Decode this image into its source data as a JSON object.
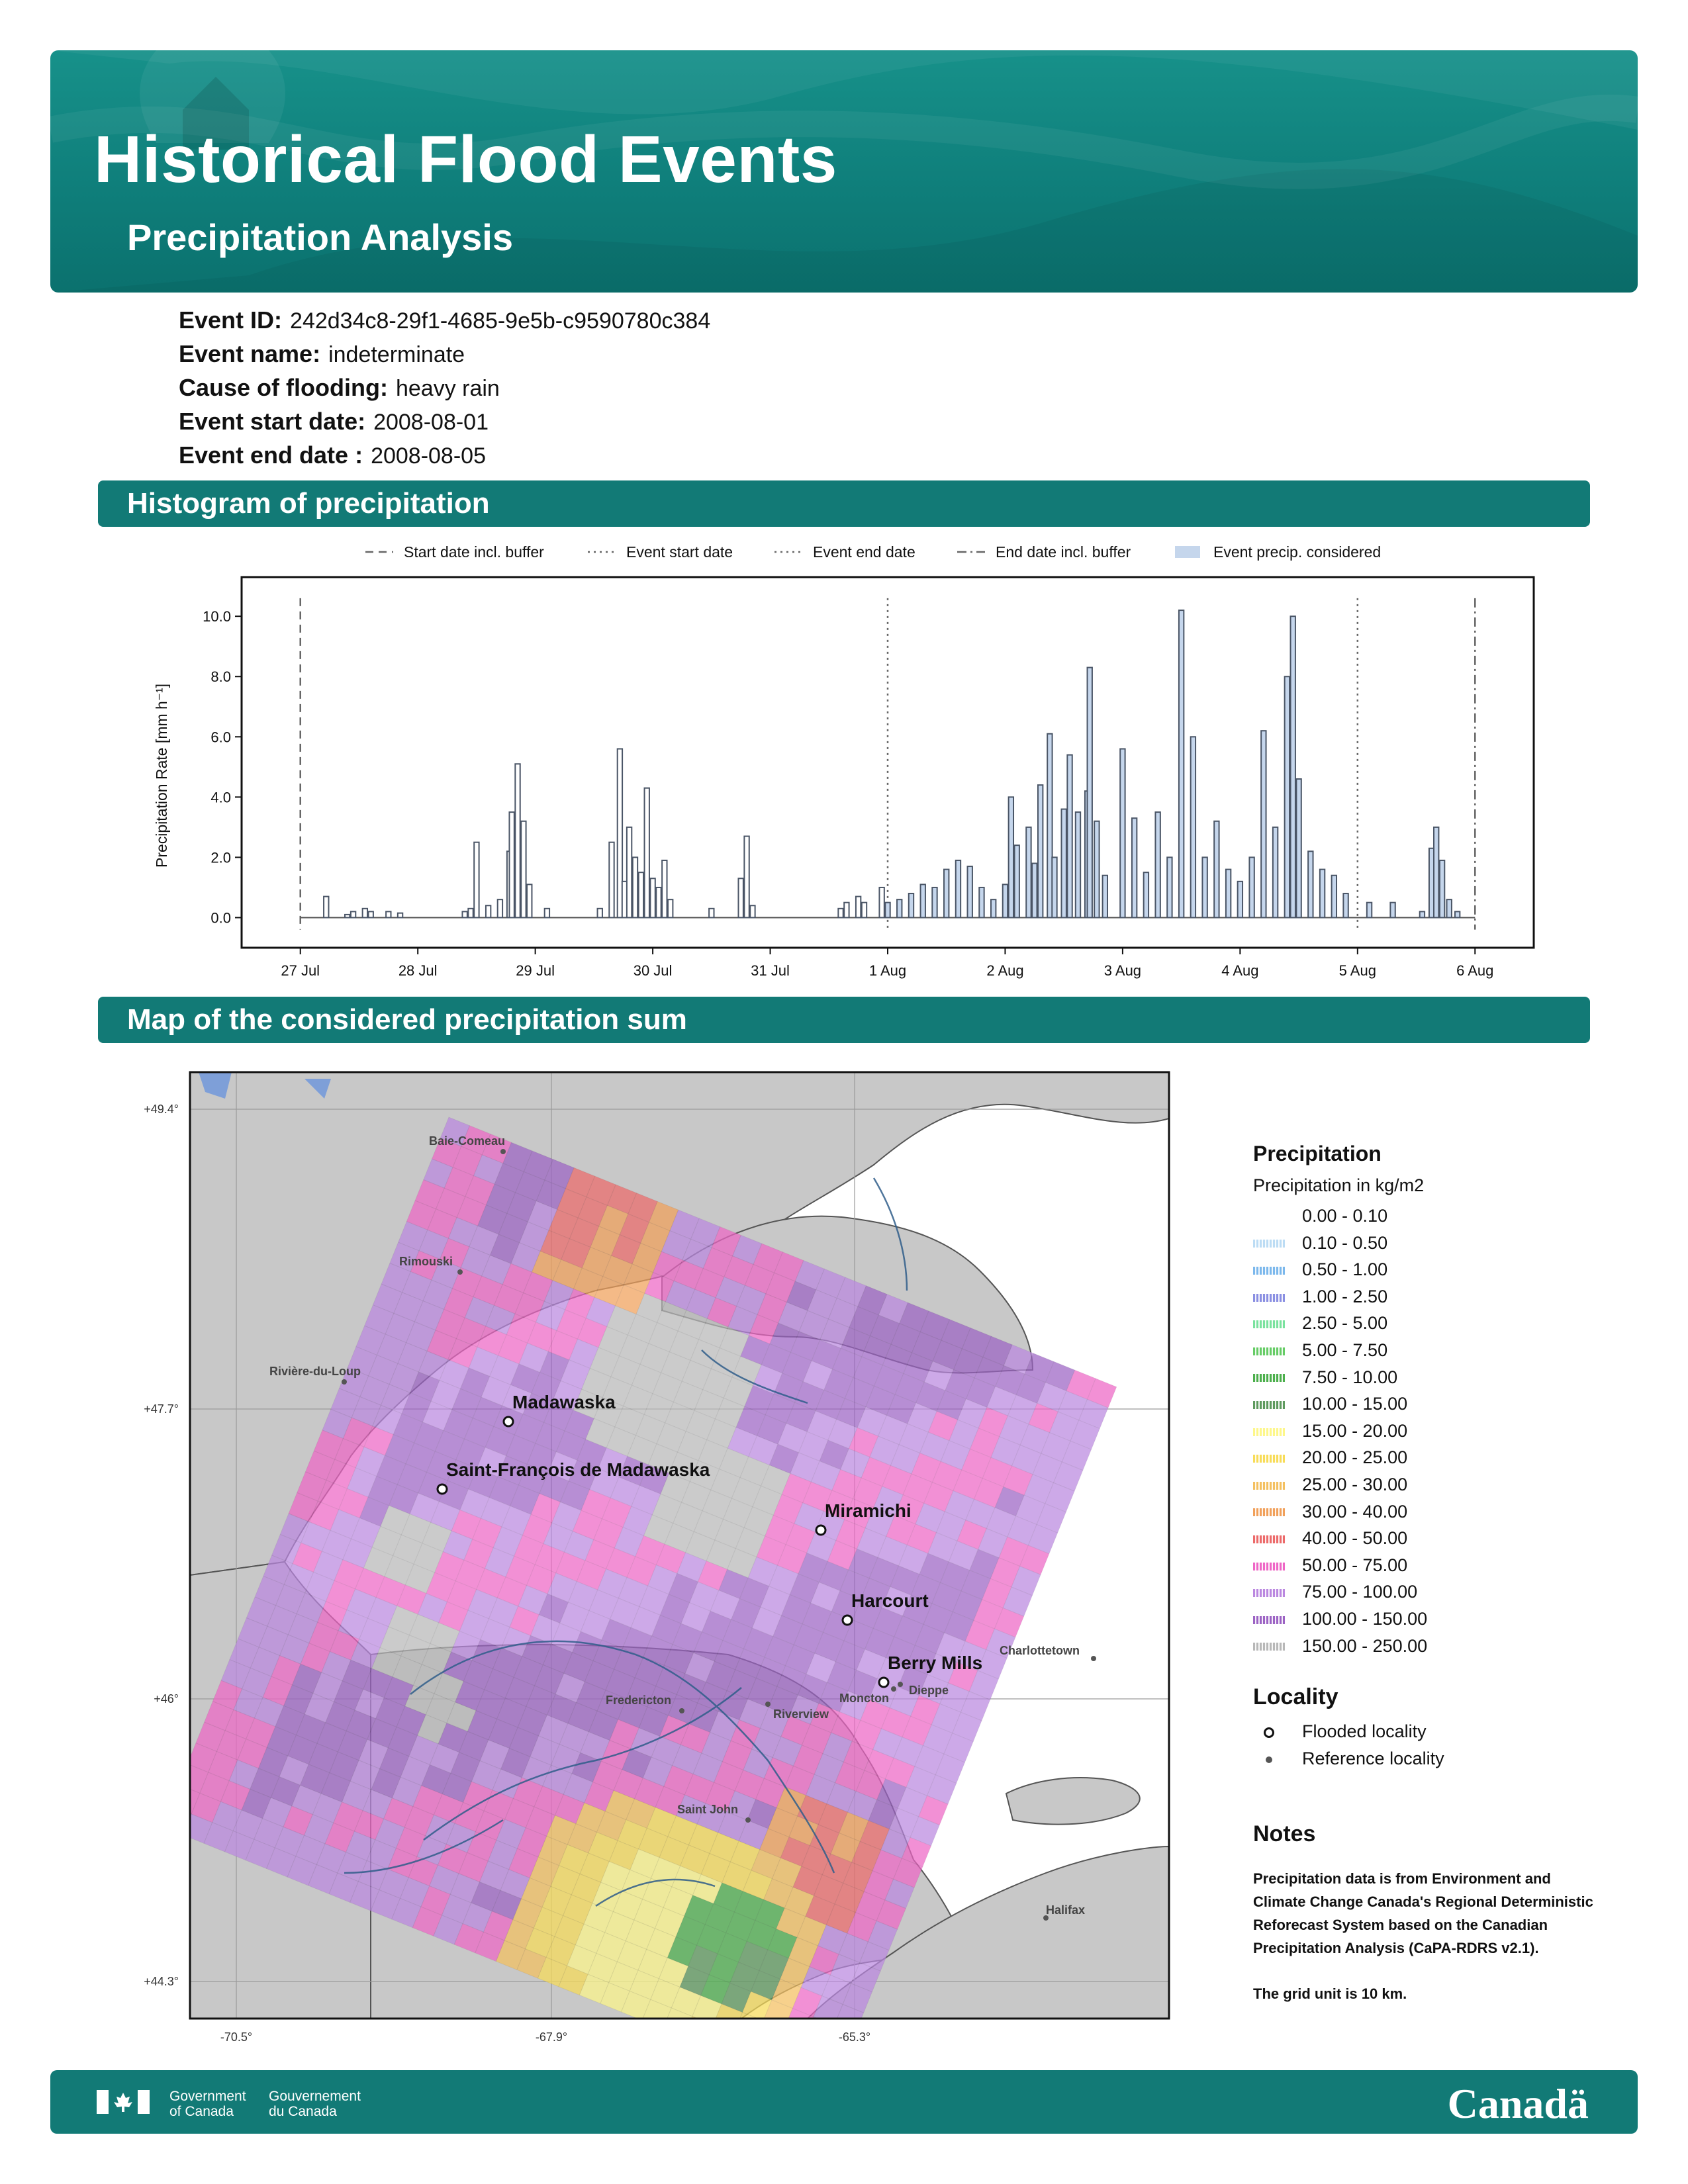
{
  "header": {
    "title": "Historical Flood Events",
    "subtitle": "Precipitation Analysis"
  },
  "event": {
    "id_label": "Event ID:",
    "id_value": "242d34c8-29f1-4685-9e5b-c9590780c384",
    "name_label": "Event name:",
    "name_value": "indeterminate",
    "cause_label": "Cause of flooding:",
    "cause_value": "heavy rain",
    "start_label": "Event start date:",
    "start_value": "2008-08-01",
    "end_label": "Event end date :",
    "end_value": "2008-08-05"
  },
  "sections": {
    "histogram": "Histogram of precipitation",
    "map": "Map of the considered precipitation sum"
  },
  "chart_data": {
    "type": "bar",
    "ylabel": "Precipitation Rate [mm h⁻¹]",
    "ylim": [
      -1.0,
      11.3
    ],
    "yticks": [
      "0.0",
      "2.0",
      "4.0",
      "6.0",
      "8.0",
      "10.0"
    ],
    "ytick_values": [
      0,
      2,
      4,
      6,
      8,
      10
    ],
    "x_ticks": [
      "27 Jul",
      "28 Jul",
      "29 Jul",
      "30 Jul",
      "31 Jul",
      "1 Aug",
      "2 Aug",
      "3 Aug",
      "4 Aug",
      "5 Aug",
      "6 Aug"
    ],
    "xlim": [
      -0.5,
      10.5
    ],
    "legend": [
      {
        "label": "Start date incl. buffer",
        "style": "dashed"
      },
      {
        "label": "Event start date",
        "style": "dotted"
      },
      {
        "label": "Event end date",
        "style": "dotted"
      },
      {
        "label": "End date incl. buffer",
        "style": "dashdot"
      },
      {
        "label": "Event precip. considered",
        "style": "patch"
      }
    ],
    "markers": {
      "buffer_start": 0,
      "event_start": 5,
      "event_end": 9,
      "buffer_end": 10
    },
    "series": [
      {
        "values": [
          [
            0.22,
            0.7
          ],
          [
            0.4,
            0.1
          ],
          [
            0.45,
            0.2
          ],
          [
            0.55,
            0.3
          ],
          [
            0.6,
            0.2
          ],
          [
            0.75,
            0.2
          ],
          [
            0.85,
            0.15
          ],
          [
            1.4,
            0.2
          ],
          [
            1.45,
            0.3
          ],
          [
            1.5,
            2.5
          ],
          [
            1.6,
            0.4
          ],
          [
            1.7,
            0.6
          ],
          [
            1.78,
            2.2
          ],
          [
            1.8,
            3.5
          ],
          [
            1.85,
            5.1
          ],
          [
            1.9,
            3.2
          ],
          [
            1.95,
            1.1
          ],
          [
            2.1,
            0.3
          ],
          [
            2.55,
            0.3
          ],
          [
            2.65,
            2.5
          ],
          [
            2.72,
            5.6
          ],
          [
            2.76,
            1.2
          ],
          [
            2.8,
            3.0
          ],
          [
            2.85,
            2.0
          ],
          [
            2.9,
            1.5
          ],
          [
            2.95,
            4.3
          ],
          [
            3.0,
            1.3
          ],
          [
            3.05,
            1.0
          ],
          [
            3.1,
            1.9
          ],
          [
            3.15,
            0.6
          ],
          [
            3.5,
            0.3
          ],
          [
            3.75,
            1.3
          ],
          [
            3.8,
            2.7
          ],
          [
            3.85,
            0.4
          ],
          [
            4.6,
            0.3
          ],
          [
            4.65,
            0.5
          ],
          [
            4.75,
            0.7
          ],
          [
            4.8,
            0.5
          ],
          [
            4.95,
            1.0
          ],
          [
            5.0,
            0.5
          ],
          [
            5.1,
            0.6
          ],
          [
            5.2,
            0.8
          ],
          [
            5.3,
            1.1
          ],
          [
            5.4,
            1.0
          ],
          [
            5.5,
            1.6
          ],
          [
            5.6,
            1.9
          ],
          [
            5.7,
            1.7
          ],
          [
            5.8,
            1.0
          ],
          [
            5.9,
            0.6
          ],
          [
            6.0,
            1.1
          ],
          [
            6.05,
            4.0
          ],
          [
            6.1,
            2.4
          ],
          [
            6.2,
            3.0
          ],
          [
            6.25,
            1.8
          ],
          [
            6.3,
            4.4
          ],
          [
            6.38,
            6.1
          ],
          [
            6.42,
            2.0
          ],
          [
            6.5,
            3.6
          ],
          [
            6.55,
            5.4
          ],
          [
            6.62,
            3.5
          ],
          [
            6.7,
            4.2
          ],
          [
            6.72,
            8.3
          ],
          [
            6.78,
            3.2
          ],
          [
            6.85,
            1.4
          ],
          [
            7.0,
            5.6
          ],
          [
            7.1,
            3.3
          ],
          [
            7.2,
            1.5
          ],
          [
            7.3,
            3.5
          ],
          [
            7.4,
            2.0
          ],
          [
            7.5,
            10.2
          ],
          [
            7.6,
            6.0
          ],
          [
            7.7,
            2.0
          ],
          [
            7.8,
            3.2
          ],
          [
            7.9,
            1.6
          ],
          [
            8.0,
            1.2
          ],
          [
            8.1,
            2.0
          ],
          [
            8.2,
            6.2
          ],
          [
            8.3,
            3.0
          ],
          [
            8.4,
            8.0
          ],
          [
            8.45,
            10.0
          ],
          [
            8.5,
            4.6
          ],
          [
            8.6,
            2.2
          ],
          [
            8.7,
            1.6
          ],
          [
            8.8,
            1.4
          ],
          [
            8.9,
            0.8
          ],
          [
            9.1,
            0.5
          ],
          [
            9.3,
            0.5
          ],
          [
            9.55,
            0.2
          ],
          [
            9.63,
            2.3
          ],
          [
            9.67,
            3.0
          ],
          [
            9.72,
            1.9
          ],
          [
            9.78,
            0.6
          ],
          [
            9.85,
            0.2
          ]
        ]
      }
    ]
  },
  "map": {
    "lon_ticks": [
      "-70.5°",
      "-67.9°",
      "-65.3°"
    ],
    "lat_ticks": [
      "+49.4°",
      "+47.7°",
      "+46°",
      "+44.3°"
    ],
    "flooded_localities": [
      "Madawaska",
      "Saint-François de Madawaska",
      "Miramichi",
      "Harcourt",
      "Berry Mills"
    ],
    "reference_localities": [
      "Baie-Comeau",
      "Rimouski",
      "Rivière-du-Loup",
      "Fredericton",
      "Riverview",
      "Moncton",
      "Dieppe",
      "Charlottetown",
      "Saint John",
      "Halifax"
    ]
  },
  "legend": {
    "title": "Precipitation",
    "unit": "Precipitation in kg/m2",
    "classes": [
      {
        "label": "0.00 - 0.10",
        "color": "#ffffff"
      },
      {
        "label": "0.10 - 0.50",
        "color": "#bcdcf4"
      },
      {
        "label": "0.50 - 1.00",
        "color": "#7cb8ec"
      },
      {
        "label": "1.00 - 2.50",
        "color": "#8a8fe2"
      },
      {
        "label": "2.50 - 5.00",
        "color": "#7ae29e"
      },
      {
        "label": "5.00 - 7.50",
        "color": "#66cc66"
      },
      {
        "label": "7.50 - 10.00",
        "color": "#4caf4c"
      },
      {
        "label": "10.00 - 15.00",
        "color": "#5e9a5e"
      },
      {
        "label": "15.00 - 20.00",
        "color": "#fdf78a"
      },
      {
        "label": "20.00 - 25.00",
        "color": "#f8dc58"
      },
      {
        "label": "25.00 - 30.00",
        "color": "#f4c060"
      },
      {
        "label": "30.00 - 40.00",
        "color": "#f1a05a"
      },
      {
        "label": "40.00 - 50.00",
        "color": "#ec6a6a"
      },
      {
        "label": "50.00 - 75.00",
        "color": "#ee66c6"
      },
      {
        "label": "75.00 - 100.00",
        "color": "#bb88e0"
      },
      {
        "label": "100.00 - 150.00",
        "color": "#9c63c4"
      },
      {
        "label": "150.00 - 250.00",
        "color": "#b8b8b8"
      }
    ],
    "locality_title": "Locality",
    "flooded_label": "Flooded locality",
    "reference_label": "Reference locality"
  },
  "notes": {
    "title": "Notes",
    "p1": "Precipitation data is from Environment and Climate Change Canada's Regional Deterministic Reforecast System based on the Canadian Precipitation Analysis (CaPA-RDRS v2.1).",
    "p2": "The grid unit is 10 km."
  },
  "footer": {
    "gov_en": "Government\nof Canada",
    "gov_fr": "Gouvernement\ndu Canada",
    "wordmark": "Canadä"
  }
}
